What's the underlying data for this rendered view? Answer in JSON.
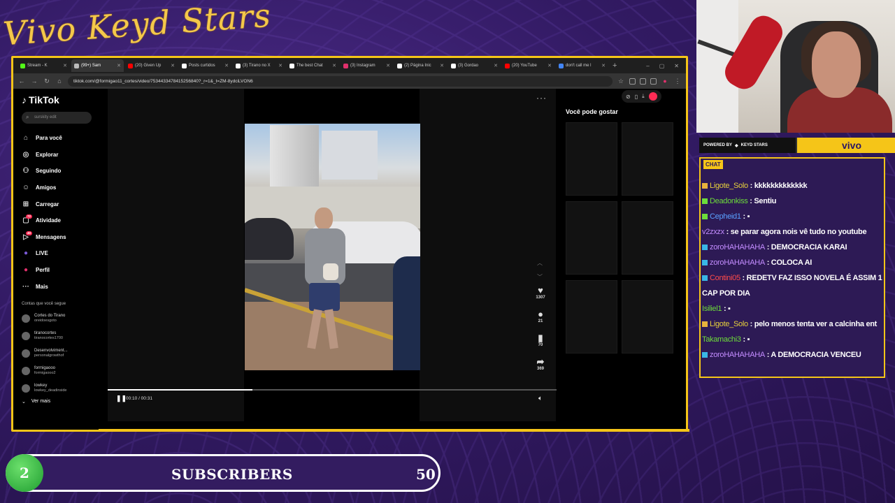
{
  "brand": "Vivo Keyd Stars",
  "browser": {
    "tabs": [
      {
        "label": "Stream - K",
        "color": "#53fc18"
      },
      {
        "label": "(99+) Sam",
        "color": "#bbbbbb"
      },
      {
        "label": "(20) Given Up",
        "color": "#ff0000"
      },
      {
        "label": "Posts curtidos",
        "color": "#ffffff"
      },
      {
        "label": "(3) Tirano no X",
        "color": "#ffffff"
      },
      {
        "label": "The best Chat",
        "color": "#ffffff"
      },
      {
        "label": "(3) Instagram",
        "color": "#e1306c"
      },
      {
        "label": "(2) Página Inic",
        "color": "#ffffff"
      },
      {
        "label": "(3) Gordao",
        "color": "#ffffff"
      },
      {
        "label": "(20) YouTube",
        "color": "#ff0000"
      },
      {
        "label": "don't call me l",
        "color": "#4285f4"
      }
    ],
    "url": "tiktok.com/@formigao11_cortes/video/7534433478415256840?_r=1&_t=ZM-8ydciLVON6"
  },
  "tiktok": {
    "logo": "TikTok",
    "search_placeholder": "surskity edit",
    "nav": [
      {
        "label": "Para você",
        "icon": "home-icon",
        "glyph": "⌂"
      },
      {
        "label": "Explorar",
        "icon": "compass-icon",
        "glyph": "◎"
      },
      {
        "label": "Seguindo",
        "icon": "following-icon",
        "glyph": "⚇"
      },
      {
        "label": "Amigos",
        "icon": "friends-icon",
        "glyph": "☺"
      },
      {
        "label": "Carregar",
        "icon": "upload-icon",
        "glyph": "⊞"
      },
      {
        "label": "Atividade",
        "icon": "activity-icon",
        "glyph": "▢",
        "badge": "72"
      },
      {
        "label": "Mensagens",
        "icon": "messages-icon",
        "glyph": "▷",
        "badge": "40"
      },
      {
        "label": "LIVE",
        "icon": "live-icon",
        "glyph": "●"
      },
      {
        "label": "Perfil",
        "icon": "profile-icon",
        "glyph": "●"
      },
      {
        "label": "Mais",
        "icon": "more-icon",
        "glyph": "···"
      }
    ],
    "following_header": "Contas que você segue",
    "following": [
      {
        "name": "Cortes do Tirano",
        "user": "oreidoesgoto"
      },
      {
        "name": "tiranocortes",
        "user": "tiranocortes1700"
      },
      {
        "name": "Desenvolviment...",
        "user": "personalgrowthof"
      },
      {
        "name": "formigaooo",
        "user": "formigaooo2"
      },
      {
        "name": "lowkey",
        "user": "lowkey_deadinside"
      }
    ],
    "see_more": "Ver mais",
    "actions": {
      "likes": "1307",
      "comments": "21",
      "saves": "70",
      "shares": "369"
    },
    "progress": 0.3226,
    "time": "00:10 / 00:31",
    "suggestions_title": "Você pode gostar"
  },
  "sponsor": {
    "powered_by": "POWERED BY",
    "keyd": "KEYD STARS",
    "vivo": "vivo"
  },
  "chat": {
    "title": "CHAT",
    "messages": [
      {
        "user": "Ligote_Solo",
        "text": ": kkkkkkkkkkkkk",
        "color": "#e7d03c",
        "badge": "#e7b23c"
      },
      {
        "user": "Deadonkiss",
        "text": ": Sentiu",
        "color": "#6ddc3a",
        "badge": "#6ddc3a"
      },
      {
        "user": "Cepheid1",
        "text": ": ▪",
        "color": "#5aa0ff",
        "badge": "#6ddc3a"
      },
      {
        "user": "v2zxzx",
        "text": ": se parar agora nois vê tudo no youtube",
        "color": "#c38cff",
        "badge": ""
      },
      {
        "user": "zoroHAHAHAHA",
        "text": ": DEMOCRACIA KARAI",
        "color": "#c38cff",
        "badge": "#39b7e6"
      },
      {
        "user": "zoroHAHAHAHA",
        "text": ": COLOCA AI",
        "color": "#c38cff",
        "badge": "#39b7e6"
      },
      {
        "user": "Contini05",
        "text": ": REDETV FAZ ISSO NOVELA É ASSIM 1 CAP POR DIA",
        "color": "#ff4a4a",
        "badge": "#39b7e6"
      },
      {
        "user": "Isiliel1",
        "text": ": ▪",
        "color": "#6ddc3a",
        "badge": ""
      },
      {
        "user": "Ligote_Solo",
        "text": ": pelo menos tenta ver a calcinha ent",
        "color": "#e7d03c",
        "badge": "#e7b23c"
      },
      {
        "user": "Takamachi3",
        "text": ": ▪",
        "color": "#6ddc3a",
        "badge": ""
      },
      {
        "user": "zoroHAHAHAHA",
        "text": ": A DEMOCRACIA VENCEU",
        "color": "#c38cff",
        "badge": "#39b7e6"
      }
    ]
  },
  "subscribers": {
    "current": "2",
    "label": "SUBSCRIBERS",
    "goal": "50"
  }
}
